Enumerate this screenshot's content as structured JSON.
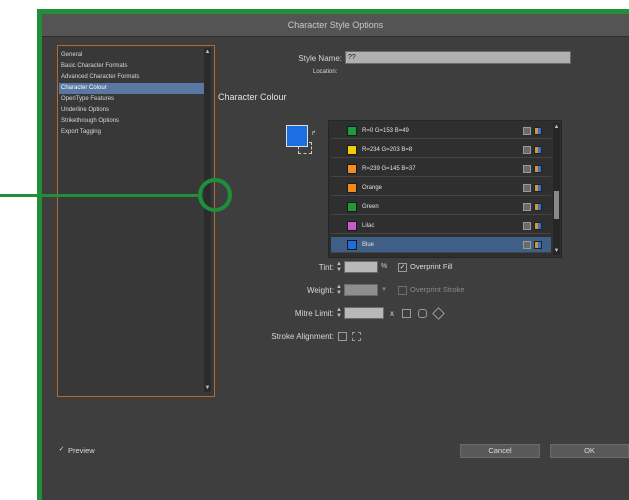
{
  "dialog": {
    "title": "Character Style Options"
  },
  "categories": [
    {
      "label": "General",
      "selected": false
    },
    {
      "label": "Basic Character Formats",
      "selected": false
    },
    {
      "label": "Advanced Character Formats",
      "selected": false
    },
    {
      "label": "Character Colour",
      "selected": true
    },
    {
      "label": "OpenType Features",
      "selected": false
    },
    {
      "label": "Underline Options",
      "selected": false
    },
    {
      "label": "Strikethrough Options",
      "selected": false
    },
    {
      "label": "Export Tagging",
      "selected": false
    }
  ],
  "style_name": {
    "label": "Style Name:",
    "value": "??",
    "location_label": "Location:"
  },
  "section": {
    "title": "Character Colour"
  },
  "swatches": [
    {
      "name": "R=0 G=153 B=49",
      "color": "#1e9a3c",
      "selected": false
    },
    {
      "name": "R=234 G=203 B=8",
      "color": "#f0cb0a",
      "selected": false
    },
    {
      "name": "R=239 G=145 B=37",
      "color": "#ef8f25",
      "selected": false
    },
    {
      "name": "Orange",
      "color": "#f08a1c",
      "selected": false
    },
    {
      "name": "Green",
      "color": "#1f9a35",
      "selected": false
    },
    {
      "name": "Lilac",
      "color": "#c45bc8",
      "selected": false
    },
    {
      "name": "Blue",
      "color": "#1c6fe0",
      "selected": true
    }
  ],
  "tint": {
    "label": "Tint:",
    "overprint_fill_label": "Overprint Fill",
    "overprint_fill_checked": true
  },
  "weight": {
    "label": "Weight:",
    "overprint_stroke_label": "Overprint Stroke",
    "overprint_stroke_checked": false
  },
  "miter": {
    "label": "Mitre Limit:",
    "x": "x"
  },
  "stroke_alignment": {
    "label": "Stroke Alignment:"
  },
  "preview": {
    "label": "Preview",
    "checked": true
  },
  "buttons": {
    "cancel": "Cancel",
    "ok": "OK"
  },
  "colors": {
    "accent_green": "#1f8f3a",
    "selection_blue": "#5878a3",
    "panel_border": "#b56b2d",
    "fill_colour": "#1c6fe0"
  }
}
